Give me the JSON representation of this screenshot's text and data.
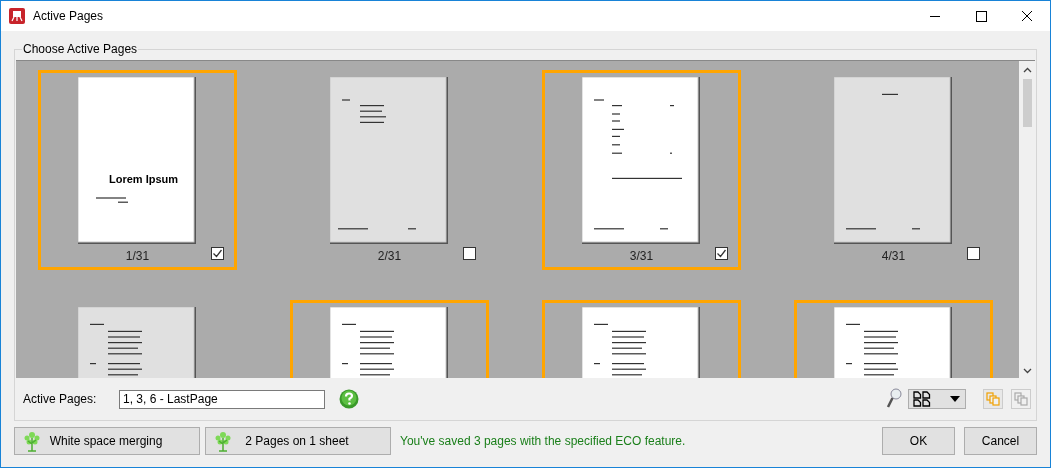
{
  "window": {
    "title": "Active Pages"
  },
  "group": {
    "title": "Choose Active Pages"
  },
  "pages": [
    {
      "label": "1/31",
      "selected": true,
      "checked": true,
      "title": "Lorem Ipsum",
      "kind": "title"
    },
    {
      "label": "2/31",
      "selected": false,
      "checked": false,
      "kind": "header"
    },
    {
      "label": "3/31",
      "selected": true,
      "checked": true,
      "kind": "table"
    },
    {
      "label": "4/31",
      "selected": false,
      "checked": false,
      "kind": "blank"
    },
    {
      "selected": false,
      "kind": "text"
    },
    {
      "selected": true,
      "kind": "text"
    },
    {
      "selected": true,
      "kind": "text"
    },
    {
      "selected": true,
      "kind": "text"
    }
  ],
  "active_pages": {
    "label": "Active Pages:",
    "value": "1, 3, 6 - LastPage"
  },
  "view_tools": [
    {
      "kind": "copy",
      "disabled": false
    },
    {
      "kind": "copy",
      "disabled": true
    }
  ],
  "eco_buttons": [
    "White space merging",
    "2 Pages on 1 sheet"
  ],
  "status": "You've saved 3 pages with the specified ECO feature.",
  "buttons": [
    "OK",
    "Cancel"
  ]
}
